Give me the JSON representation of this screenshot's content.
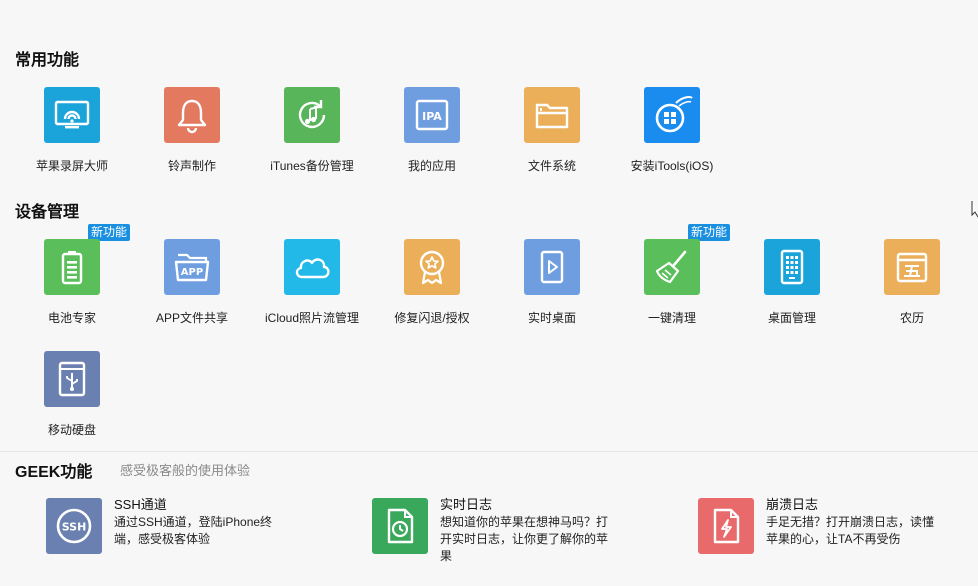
{
  "sections": {
    "common": {
      "title": "常用功能"
    },
    "device": {
      "title": "设备管理"
    },
    "geek": {
      "title": "GEEK功能",
      "subtitle": "感受极客般的使用体验"
    }
  },
  "common_tools": [
    {
      "label": "苹果录屏大师",
      "icon": "screen-mirror-icon",
      "color": "#1aa4d9"
    },
    {
      "label": "铃声制作",
      "icon": "bell-icon",
      "color": "#e3795e"
    },
    {
      "label": "iTunes备份管理",
      "icon": "music-refresh-icon",
      "color": "#58b55a"
    },
    {
      "label": "我的应用",
      "icon": "ipa-icon",
      "color": "#6f9ee0"
    },
    {
      "label": "文件系统",
      "icon": "folder-icon",
      "color": "#ebaf5a"
    },
    {
      "label": "安装iTools(iOS)",
      "icon": "itools-icon",
      "color": "#1a8cf0"
    }
  ],
  "device_tools": [
    {
      "label": "电池专家",
      "icon": "battery-icon",
      "color": "#5abf5a",
      "badge": "新功能"
    },
    {
      "label": "APP文件共享",
      "icon": "app-folder-icon",
      "color": "#6f9ee0",
      "badge": ""
    },
    {
      "label": "iCloud照片流管理",
      "icon": "cloud-icon",
      "color": "#22b8e8",
      "badge": ""
    },
    {
      "label": "修复闪退/授权",
      "icon": "award-star-icon",
      "color": "#ebaf5a",
      "badge": ""
    },
    {
      "label": "实时桌面",
      "icon": "play-screen-icon",
      "color": "#6f9ee0",
      "badge": ""
    },
    {
      "label": "一键清理",
      "icon": "broom-icon",
      "color": "#5abf5a",
      "badge": "新功能"
    },
    {
      "label": "桌面管理",
      "icon": "phone-grid-icon",
      "color": "#1aa4d9",
      "badge": ""
    },
    {
      "label": "农历",
      "icon": "calendar-icon",
      "color": "#ebaf5a",
      "badge": ""
    },
    {
      "label": "移动硬盘",
      "icon": "usb-drive-icon",
      "color": "#6a80b0",
      "badge": ""
    }
  ],
  "geek_tools": [
    {
      "title": "SSH通道",
      "desc": "通过SSH通道，登陆iPhone终端，感受极客体验",
      "icon": "ssh-icon",
      "color": "#6a80b0"
    },
    {
      "title": "实时日志",
      "desc": "想知道你的苹果在想神马吗？打开实时日志，让你更了解你的苹果",
      "icon": "clock-doc-icon",
      "color": "#3aa85a"
    },
    {
      "title": "崩溃日志",
      "desc": "手足无措？打开崩溃日志，读懂苹果的心，让TA不再受伤",
      "icon": "crash-doc-icon",
      "color": "#e86a6a"
    }
  ]
}
